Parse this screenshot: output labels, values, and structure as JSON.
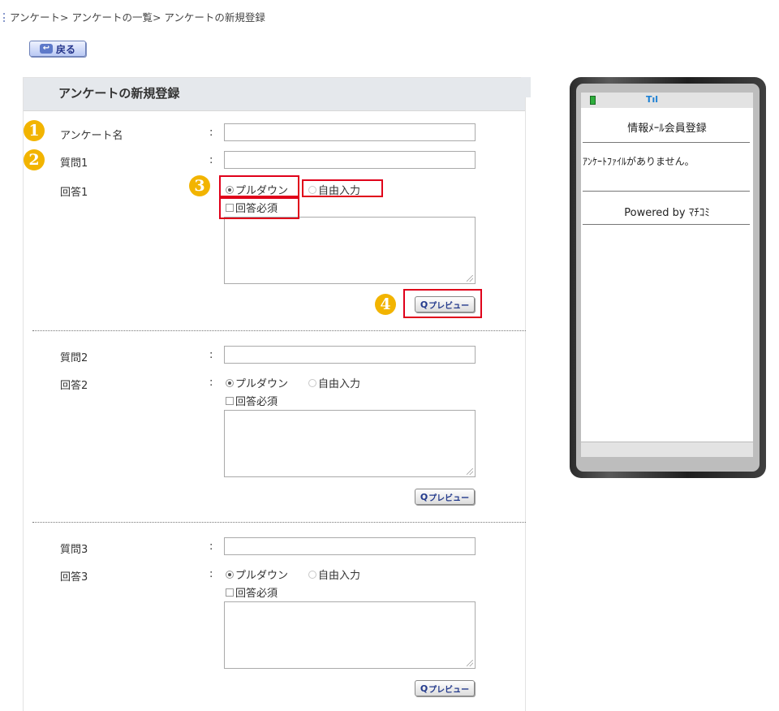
{
  "breadcrumb": "アンケート> アンケートの一覧> アンケートの新規登録",
  "back_button": "戻る",
  "panel_title": "アンケートの新規登録",
  "colon": ":",
  "survey_name_label": "アンケート名",
  "questions": [
    {
      "question_label": "質問1",
      "answer_label": "回答1",
      "pulldown": "プルダウン",
      "free_input": "自由入力",
      "required": "回答必須",
      "preview": "プレビュー",
      "selected": "プルダウン"
    },
    {
      "question_label": "質問2",
      "answer_label": "回答2",
      "pulldown": "プルダウン",
      "free_input": "自由入力",
      "required": "回答必須",
      "preview": "プレビュー",
      "selected": "プルダウン"
    },
    {
      "question_label": "質問3",
      "answer_label": "回答3",
      "pulldown": "プルダウン",
      "free_input": "自由入力",
      "required": "回答必須",
      "preview": "プレビュー",
      "selected": "プルダウン"
    }
  ],
  "preview_icon": "Q",
  "callouts": [
    "1",
    "2",
    "3",
    "4"
  ],
  "mobile_preview": {
    "title": "情報ﾒｰﾙ会員登録",
    "message": "ｱﾝｹｰﾄﾌｧｲﾙがありません。",
    "powered_by": "Powered by ﾏﾁｺﾐ",
    "signal": "Tıl"
  },
  "colors": {
    "callout": "#f2b400",
    "highlight": "#e0001a",
    "link": "#233a8c"
  }
}
